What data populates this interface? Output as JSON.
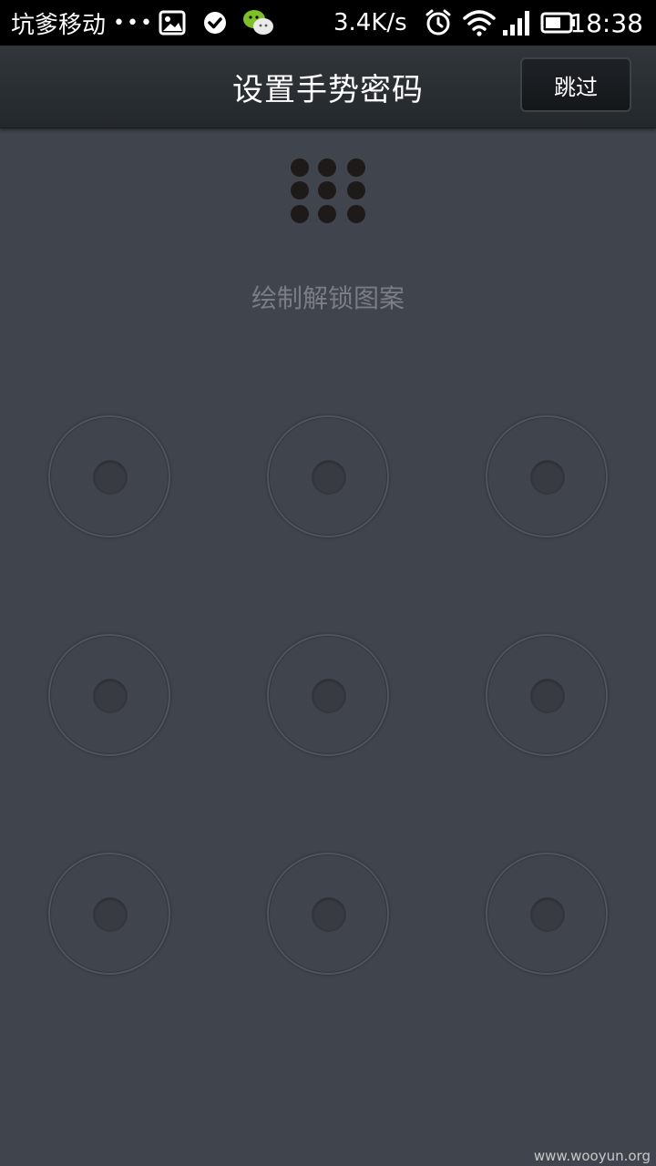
{
  "status_bar": {
    "carrier": "坑爹移动",
    "overflow_dots": "•••",
    "speed": "3.4K/s",
    "time": "18:38",
    "icons": [
      "gallery-icon",
      "check-icon",
      "wechat-icon",
      "alarm-icon",
      "wifi-icon",
      "signal-icon",
      "battery-icon"
    ]
  },
  "header": {
    "title": "设置手势密码",
    "skip_label": "跳过"
  },
  "hint": "绘制解锁图案",
  "pattern": {
    "rows": 3,
    "cols": 3
  },
  "watermark": "www.wooyun.org",
  "colors": {
    "background": "#40444c",
    "status_bar": "#000000",
    "title_bar": "#2b3034",
    "hint_text": "#7a7d83"
  }
}
